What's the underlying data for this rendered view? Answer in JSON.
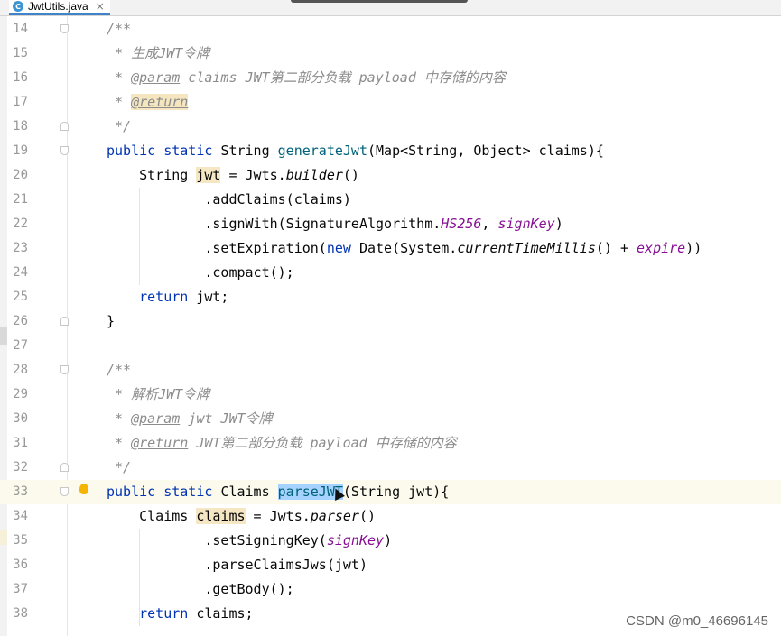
{
  "tab": {
    "file_icon": "C",
    "title": "JwtUtils.java",
    "close": "×"
  },
  "lines": [
    {
      "n": "14",
      "tokens": [
        {
          "t": "/**",
          "c": "cm"
        }
      ]
    },
    {
      "n": "15",
      "tokens": [
        {
          "t": " * 生成JWT令牌",
          "c": "cm"
        }
      ]
    },
    {
      "n": "16",
      "tokens": [
        {
          "t": " * ",
          "c": "cm"
        },
        {
          "t": "@param",
          "c": "tag"
        },
        {
          "t": " claims",
          "c": "cm"
        },
        {
          "t": " JWT第二部分负载 payload 中存储的内容",
          "c": "cm"
        }
      ]
    },
    {
      "n": "17",
      "tokens": [
        {
          "t": " * ",
          "c": "cm"
        },
        {
          "t": "@return",
          "c": "tag tagbg"
        }
      ]
    },
    {
      "n": "18",
      "tokens": [
        {
          "t": " */",
          "c": "cm"
        }
      ]
    },
    {
      "n": "19",
      "tokens": [
        {
          "t": "public static ",
          "c": "kw"
        },
        {
          "t": "String ",
          "c": ""
        },
        {
          "t": "generateJwt",
          "c": "fn"
        },
        {
          "t": "(Map<String, Object> claims){",
          "c": ""
        }
      ]
    },
    {
      "n": "20",
      "tokens": [
        {
          "t": "    String ",
          "c": ""
        },
        {
          "t": "jwt",
          "c": "hl"
        },
        {
          "t": " = Jwts.",
          "c": ""
        },
        {
          "t": "builder",
          "c": "it"
        },
        {
          "t": "()",
          "c": ""
        }
      ]
    },
    {
      "n": "21",
      "tokens": [
        {
          "t": "            .addClaims(claims)",
          "c": ""
        }
      ]
    },
    {
      "n": "22",
      "tokens": [
        {
          "t": "            .signWith(SignatureAlgorithm.",
          "c": ""
        },
        {
          "t": "HS256",
          "c": "st"
        },
        {
          "t": ", ",
          "c": ""
        },
        {
          "t": "signKey",
          "c": "st"
        },
        {
          "t": ")",
          "c": ""
        }
      ]
    },
    {
      "n": "23",
      "tokens": [
        {
          "t": "            .setExpiration(",
          "c": ""
        },
        {
          "t": "new ",
          "c": "kw"
        },
        {
          "t": "Date(System.",
          "c": ""
        },
        {
          "t": "currentTimeMillis",
          "c": "it"
        },
        {
          "t": "() + ",
          "c": ""
        },
        {
          "t": "expire",
          "c": "st"
        },
        {
          "t": "))",
          "c": ""
        }
      ]
    },
    {
      "n": "24",
      "tokens": [
        {
          "t": "            .compact();",
          "c": ""
        }
      ]
    },
    {
      "n": "25",
      "tokens": [
        {
          "t": "    ",
          "c": ""
        },
        {
          "t": "return ",
          "c": "kw"
        },
        {
          "t": "jwt;",
          "c": ""
        }
      ]
    },
    {
      "n": "26",
      "tokens": [
        {
          "t": "}",
          "c": ""
        }
      ]
    },
    {
      "n": "27",
      "tokens": [
        {
          "t": "",
          "c": ""
        }
      ]
    },
    {
      "n": "28",
      "tokens": [
        {
          "t": "/**",
          "c": "cm"
        }
      ]
    },
    {
      "n": "29",
      "tokens": [
        {
          "t": " * 解析JWT令牌",
          "c": "cm"
        }
      ]
    },
    {
      "n": "30",
      "tokens": [
        {
          "t": " * ",
          "c": "cm"
        },
        {
          "t": "@param",
          "c": "tag"
        },
        {
          "t": " jwt",
          "c": "cm"
        },
        {
          "t": " JWT令牌",
          "c": "cm"
        }
      ]
    },
    {
      "n": "31",
      "tokens": [
        {
          "t": " * ",
          "c": "cm"
        },
        {
          "t": "@return",
          "c": "tag"
        },
        {
          "t": " JWT第二部分负载 payload 中存储的内容",
          "c": "cm"
        }
      ]
    },
    {
      "n": "32",
      "tokens": [
        {
          "t": " */",
          "c": "cm"
        }
      ]
    },
    {
      "n": "33",
      "tokens": [
        {
          "t": "public static ",
          "c": "kw"
        },
        {
          "t": "Claims ",
          "c": ""
        },
        {
          "t": "parseJWT",
          "c": "fn sel"
        },
        {
          "t": "(String jwt){",
          "c": ""
        }
      ]
    },
    {
      "n": "34",
      "tokens": [
        {
          "t": "    Claims ",
          "c": ""
        },
        {
          "t": "claims",
          "c": "hl"
        },
        {
          "t": " = Jwts.",
          "c": ""
        },
        {
          "t": "parser",
          "c": "it"
        },
        {
          "t": "()",
          "c": ""
        }
      ]
    },
    {
      "n": "35",
      "tokens": [
        {
          "t": "            .setSigningKey(",
          "c": ""
        },
        {
          "t": "signKey",
          "c": "st"
        },
        {
          "t": ")",
          "c": ""
        }
      ]
    },
    {
      "n": "36",
      "tokens": [
        {
          "t": "            .parseClaimsJws(jwt)",
          "c": ""
        }
      ]
    },
    {
      "n": "37",
      "tokens": [
        {
          "t": "            .getBody();",
          "c": ""
        }
      ]
    },
    {
      "n": "38",
      "tokens": [
        {
          "t": "    ",
          "c": ""
        },
        {
          "t": "return ",
          "c": "kw"
        },
        {
          "t": "claims;",
          "c": ""
        }
      ]
    }
  ],
  "current_line": "33",
  "watermark": "CSDN @m0_46696145",
  "icons": [
    "java-class-icon",
    "close-icon",
    "fold-icon",
    "intention-bulb-icon",
    "mouse-pointer-icon"
  ]
}
